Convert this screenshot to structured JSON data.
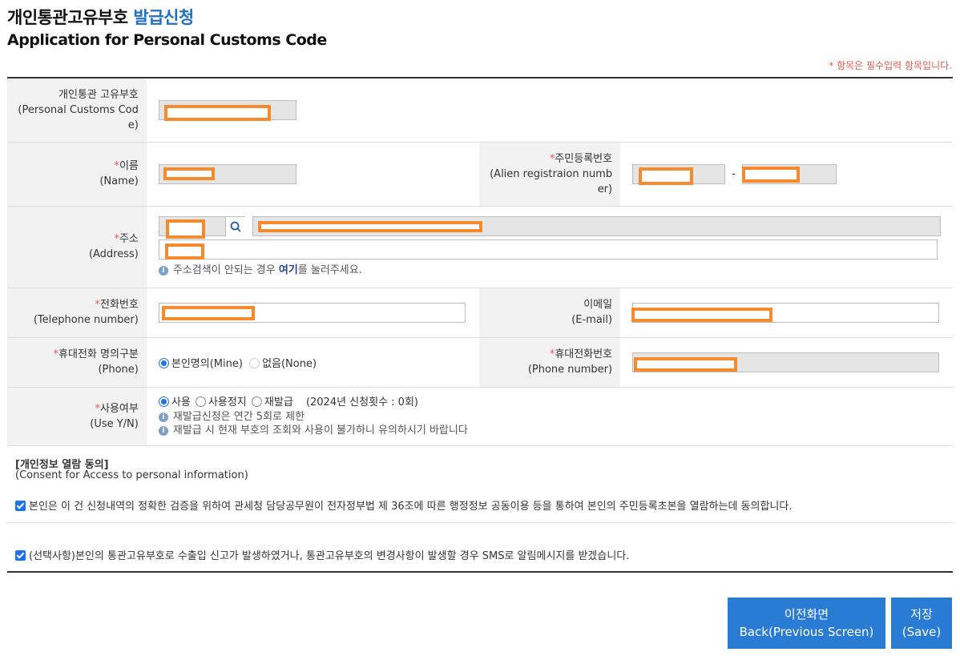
{
  "header": {
    "title_ko_part1": "개인통관고유부호",
    "title_ko_part2": "발급신청",
    "title_en": "Application for Personal Customs Code",
    "required_note": "* 항목은 필수입력 항목입니다."
  },
  "fields": {
    "customs_code": {
      "label_ko": "개인통관 고유부호",
      "label_en_1": "(Personal Customs Cod",
      "label_en_2": "e)"
    },
    "name": {
      "label_ko": "이름",
      "label_en": "(Name)"
    },
    "alien_reg": {
      "label_ko": "주민등록번호",
      "label_en_1": "(Alien registraion numb",
      "label_en_2": "er)",
      "dash": "-"
    },
    "address": {
      "label_ko": "주소",
      "label_en": "(Address)",
      "hint_prefix": "주소검색이 안되는 경우 ",
      "hint_link": "여기",
      "hint_suffix": "를 눌러주세요."
    },
    "telephone": {
      "label_ko": "전화번호",
      "label_en": "(Telephone number)"
    },
    "email": {
      "label_ko": "이메일",
      "label_en": "(E-mail)"
    },
    "phone_owner": {
      "label_ko": "휴대전화 명의구분",
      "label_en": "(Phone)",
      "option_mine": "본인명의(Mine)",
      "option_none": "없음(None)"
    },
    "mobile": {
      "label_ko": "휴대전화번호",
      "label_en": "(Phone number)"
    },
    "use_yn": {
      "label_ko": "사용여부",
      "label_en": "(Use Y/N)",
      "option_use": "사용",
      "option_suspend": "사용정지",
      "option_reissue": "재발급",
      "count_text": "(2024년 신청횟수 : 0회)",
      "note1": "재발급신청은 연간 5회로 제한",
      "note2": "재발급 시 현재 부호의 조회와 사용이 불가하니 유의하시기 바랍니다"
    }
  },
  "consent": {
    "title_ko": "[개인정보 열람 동의]",
    "title_en": "(Consent for Access to personal information)",
    "agree_text": "본인은 이 건 신청내역의 정확한 검증을 위하여 관세청 담당공무원이 전자정부법 제 36조에 따른 행정정보 공동이용 등을 통하여 본인의 주민등록초본을 열람하는데 동의합니다.",
    "sms_text": "(선택사항)본인의 통관고유부호로 수출입 신고가 발생하였거나, 통관고유부호의 변경사항이 발생할 경우 SMS로 알림메시지를 받겠습니다."
  },
  "buttons": {
    "back_ko": "이전화면",
    "back_en": "Back(Previous Screen)",
    "save_ko": "저장",
    "save_en": "(Save)"
  },
  "colors": {
    "accent": "#2a7bd3",
    "title_highlight": "#1f6fc5",
    "required": "#e85a4f",
    "redaction": "#f78a2d"
  },
  "icons": {
    "search": "search-icon",
    "info": "info-icon"
  }
}
